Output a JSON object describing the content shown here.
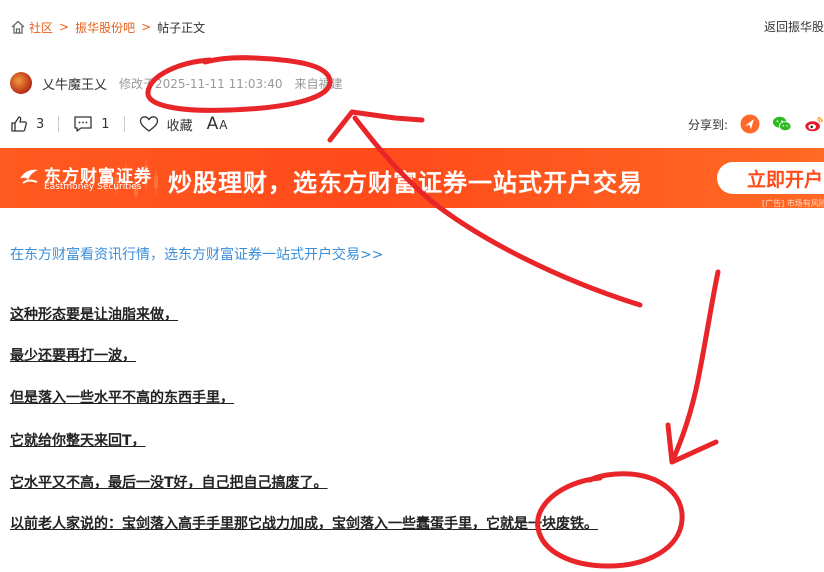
{
  "breadcrumb": {
    "items": [
      "社区",
      "振华股份吧"
    ],
    "current": "帖子正文",
    "separator": ">"
  },
  "header": {
    "back_link": "返回振华股"
  },
  "post": {
    "author": "乂牛魔王乂",
    "modified": "修改于2025-11-11 11:03:40",
    "location": "来自福建"
  },
  "actions": {
    "likes": "3",
    "comments": "1",
    "favorite_label": "收藏",
    "font_size_label_big": "A",
    "font_size_label_small": "A",
    "share_label": "分享到:"
  },
  "ad": {
    "brand_cn": "东方财富证券",
    "brand_en": "Eastmoney Securities",
    "slogan": "炒股理财，选东方财富证券一站式开户交易",
    "cta": "立即开户",
    "note": "[广告] 市场有风险"
  },
  "promo_link": "在东方财富看资讯行情，选东方财富证券一站式开户交易>>",
  "content": {
    "lines": [
      "这种形态要是让油脂来做，",
      "最少还要再打一波，",
      "但是落入一些水平不高的东西手里，",
      "它就给你整天来回T，",
      "它水平又不高，最后一没T好，自己把自己搞废了。",
      "以前老人家说的：宝剑落入高手手里那它战力加成，宝剑落入一些蠢蛋手里，它就是一块废铁。"
    ]
  },
  "colors": {
    "accent": "#e8601c",
    "banner": "#ff4a1a",
    "link": "#3a8ed8",
    "annotation": "#e8262a"
  },
  "icons": [
    "home-icon",
    "thumbs-up-icon",
    "comment-icon",
    "heart-icon",
    "share-icon",
    "wechat-icon",
    "weibo-icon"
  ]
}
